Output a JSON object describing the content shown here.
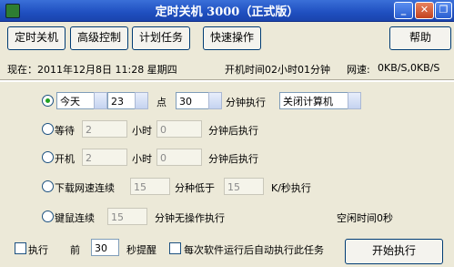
{
  "window": {
    "title": "定时关机 3000（正式版）"
  },
  "toolbar": {
    "shutdown": "定时关机",
    "advanced": "高级控制",
    "plan": "计划任务",
    "quick": "快速操作",
    "help": "帮助"
  },
  "status": {
    "now": "现在：2011年12月8日 11:28 星期四",
    "uptime": "开机时间02小时01分钟",
    "net_label": "网速:",
    "net_value": "0KB/S,0KB/S"
  },
  "opt1": {
    "day": "今天",
    "hour": "23",
    "point": "点",
    "minute": "30",
    "exec": "分钟执行",
    "action": "关闭计算机"
  },
  "opt2": {
    "label": "等待",
    "hours": "2",
    "h_unit": "小时",
    "minutes": "0",
    "m_unit": "分钟后执行"
  },
  "opt3": {
    "label": "开机",
    "hours": "2",
    "h_unit": "小时",
    "minutes": "0",
    "m_unit": "分钟后执行"
  },
  "opt4": {
    "label": "下载网速连续",
    "minutes": "15",
    "below": "分种低于",
    "speed": "15",
    "unit": "K/秒执行"
  },
  "opt5": {
    "label": "键鼠连续",
    "minutes": "15",
    "unit": "分钟无操作执行",
    "idle": "空闲时间0秒"
  },
  "bottom": {
    "remind_a": "执行",
    "remind_b": "前",
    "remind_value": "30",
    "remind_unit": "秒提醒",
    "auto_label": "每次软件运行后自动执行此任务",
    "start": "开始执行"
  }
}
